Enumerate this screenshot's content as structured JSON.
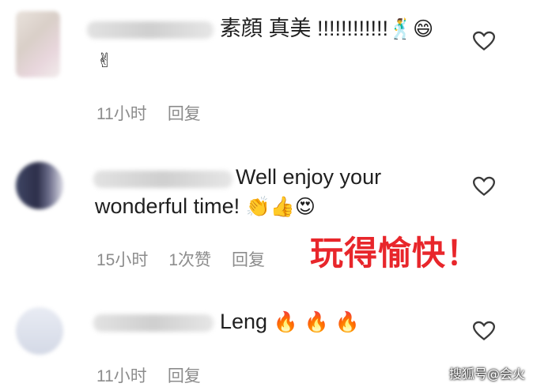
{
  "comments": [
    {
      "text": "素顔 真美 !!!!!!!!!!!!",
      "emojis": "🕺😄",
      "emojis_line2": "✌",
      "time": "11小时",
      "reply": "回复"
    },
    {
      "text_line1": "Well enjoy your",
      "text_line2": "wonderful time!",
      "emojis": "👏👍😍",
      "time": "15小时",
      "likes": "1次赞",
      "reply": "回复"
    },
    {
      "text": "Leng",
      "emojis": "🔥 🔥 🔥",
      "time": "11小时",
      "reply": "回复"
    }
  ],
  "overlay_caption": "玩得愉快！",
  "watermark": "搜狐号@会火",
  "colors": {
    "overlay": "#e8262b",
    "meta": "#8c8c8c",
    "text": "#1f1f1f"
  },
  "icons": [
    "heart-outline-icon"
  ]
}
